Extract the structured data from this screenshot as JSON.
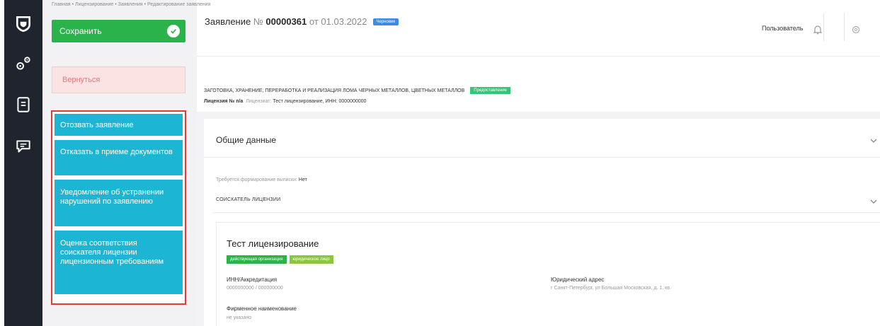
{
  "breadcrumb": [
    "Главная",
    "Лицензирование",
    "Заявления",
    "Редактирование заявления"
  ],
  "header": {
    "title_prefix": "Заявление",
    "title_number_label": "№",
    "title_number": "00000361",
    "title_date_prefix": "от",
    "title_date": "01.03.2022",
    "status_badge": "Черновик",
    "user_label": "Пользователь"
  },
  "actions": {
    "save_label": "Сохранить",
    "back_label": "Вернуться",
    "group": [
      {
        "label": "Отозвать заявление"
      },
      {
        "label": "Отказать в приеме документов"
      },
      {
        "label": "Уведомление об устранении нарушений по заявлению"
      },
      {
        "label": "Оценка соответствия соискателя лицензии лицензионным требованиям"
      }
    ]
  },
  "activity": {
    "text": "ЗАГОТОВКА, ХРАНЕНИЕ, ПЕРЕРАБОТКА И РЕАЛИЗАЦИЯ ЛОМА ЧЕРНЫХ МЕТАЛЛОВ, ЦВЕТНЫХ МЕТАЛЛОВ",
    "badge": "Предоставление",
    "license_label": "Лицензия № n/a",
    "licensee_label": "Лицензиат:",
    "licensee_value": "Тест лицензирование, ИНН: 0000000000"
  },
  "general": {
    "title": "Общие данные",
    "extract_label": "Требуется формирование выписки:",
    "extract_value": "Нет",
    "applicant_title": "СОИСКАТЕЛЬ ЛИЦЕНЗИИ"
  },
  "organization": {
    "name": "Тест лицензирование",
    "badges": [
      "действующая организация",
      "юридическое лицо"
    ],
    "inn_label": "ИНН/Аккредитация",
    "inn_value": "0000000000 / 000000000",
    "address_label": "Юридический адрес",
    "address_value": "г Санкт-Петербург, ул Большая Московская, д. 1, кв.",
    "brand_label": "Фирменное наименование",
    "brand_value": "не указано"
  },
  "colors": {
    "rail": "#1f242e",
    "save": "#2bb34b",
    "action": "#1cb5d3",
    "highlight_border": "#e53935",
    "badge_blue": "#3d8ce3"
  },
  "icons": {
    "rail": [
      "shield-logo-icon",
      "gears-icon",
      "document-icon",
      "chat-icon"
    ],
    "header": [
      "bell-icon",
      "settings-icon"
    ]
  }
}
